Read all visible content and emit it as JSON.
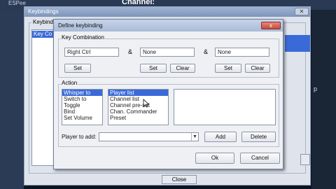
{
  "background": {
    "app_title": "ESPee",
    "channel_label": "Channel:",
    "right_letter": "p"
  },
  "keybindings_window": {
    "title": "Keybindings",
    "group_label": "Keybindings",
    "list_row": "Key Co",
    "close_label": "Close"
  },
  "dialog": {
    "title": "Define keybinding",
    "close_glyph": "x",
    "key_combination": {
      "label": "Key Combination",
      "fields": [
        "Right Ctrl",
        "None",
        "None"
      ],
      "separator": "&",
      "set_label": "Set",
      "clear_label": "Clear"
    },
    "action": {
      "label": "Action",
      "actions": [
        "Whisper to",
        "Switch to",
        "Toggle",
        "Bind",
        "Set Volume"
      ],
      "selected_action": 0,
      "targets": [
        "Player list",
        "Channel list",
        "Channel pre-set",
        "Chan. Commander",
        "Preset"
      ],
      "selected_target": 0,
      "player_label": "Player to add:",
      "player_value": "",
      "add_label": "Add",
      "delete_label": "Delete"
    },
    "ok_label": "Ok",
    "cancel_label": "Cancel"
  }
}
